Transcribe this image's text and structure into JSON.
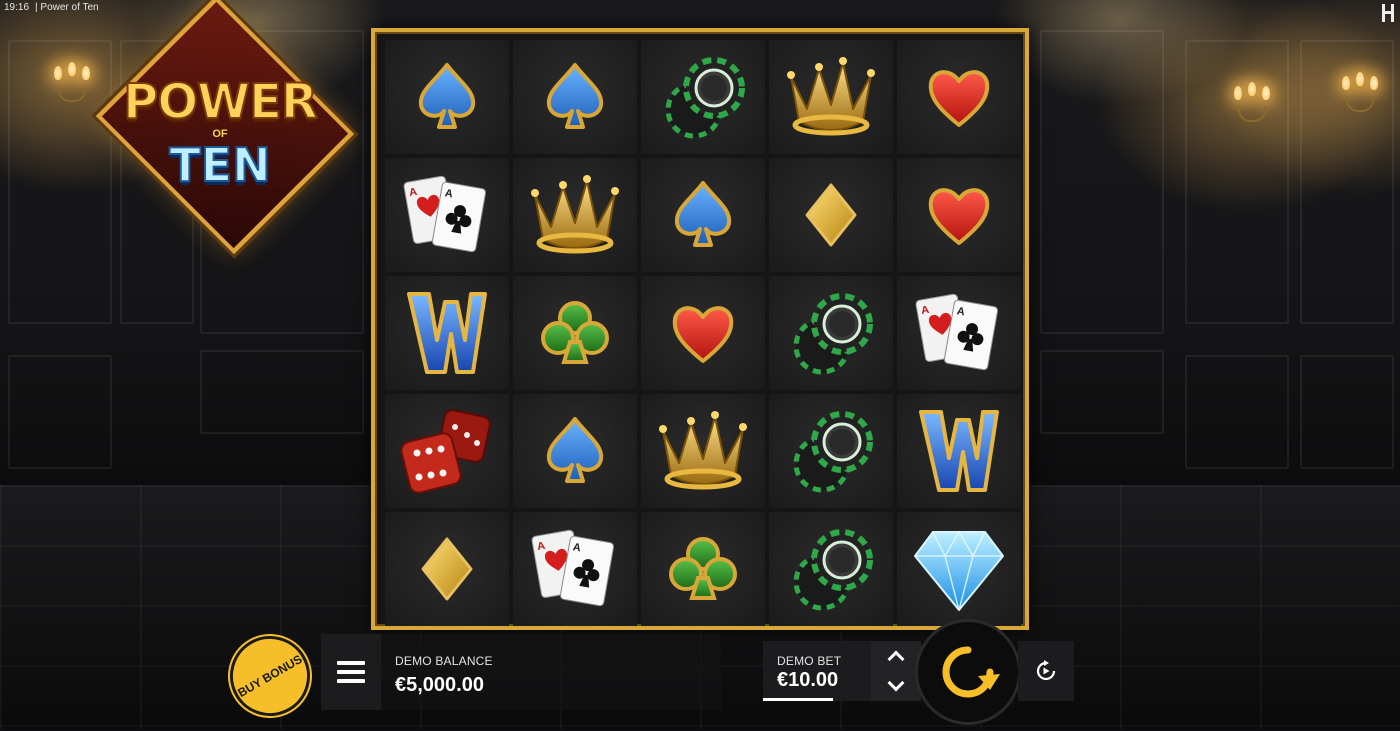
{
  "status_bar": {
    "time": "19:16",
    "title": "| Power of Ten"
  },
  "logo": {
    "line1": "POWER",
    "line2": "OF",
    "line3": "TEN"
  },
  "reels": {
    "rows": [
      [
        "blue-spade",
        "blue-spade",
        "green-chips",
        "gold-crown",
        "red-heart"
      ],
      [
        "ace-pair-cards",
        "gold-crown",
        "blue-spade",
        "gold-diamond",
        "red-heart"
      ],
      [
        "wild-w",
        "green-club",
        "red-heart",
        "green-chips",
        "ace-pair-cards"
      ],
      [
        "red-dice",
        "blue-spade",
        "gold-crown",
        "green-chips",
        "wild-w"
      ],
      [
        "gold-diamond",
        "ace-pair-cards",
        "green-club",
        "green-chips",
        "blue-gem"
      ]
    ]
  },
  "controls": {
    "buy_bonus_label": "BUY BONUS",
    "balance_label": "DEMO BALANCE",
    "balance_value": "€5,000.00",
    "bet_label": "DEMO BET",
    "bet_value": "€10.00"
  },
  "colors": {
    "accent": "#f6bf2a",
    "frame": "#d8a83a"
  }
}
